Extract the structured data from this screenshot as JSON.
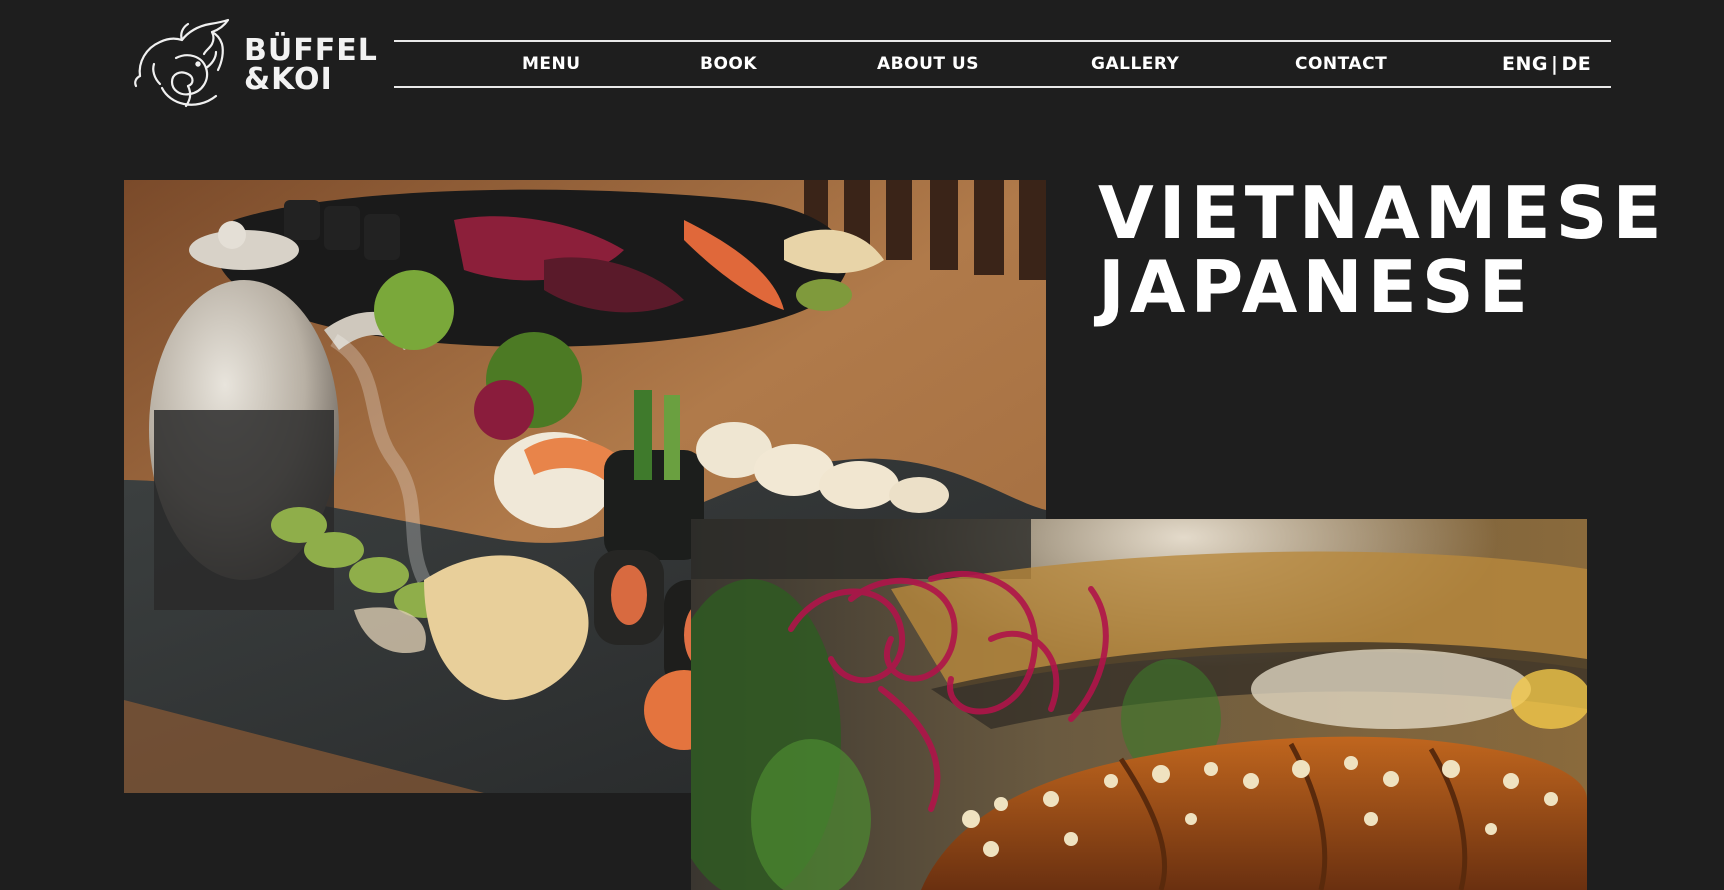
{
  "brand": {
    "logo_icon": "bull-and-koi-icon",
    "name_line1": "BÜFFEL",
    "name_line2": "&KOI"
  },
  "nav": {
    "items": [
      {
        "label": "MENU"
      },
      {
        "label": "BOOK"
      },
      {
        "label": "ABOUT US"
      },
      {
        "label": "GALLERY"
      },
      {
        "label": "CONTACT"
      }
    ],
    "language": {
      "current": "ENG",
      "separator": "|",
      "other": "DE"
    }
  },
  "hero": {
    "headline_line1": "VIETNAMESE",
    "headline_line2": "JAPANESE",
    "images": [
      {
        "name": "sushi-platter-photo"
      },
      {
        "name": "glazed-dish-photo"
      }
    ]
  },
  "colors": {
    "background": "#1e1e1e",
    "text": "#ffffff",
    "nav_rule": "#e9e9e9"
  }
}
